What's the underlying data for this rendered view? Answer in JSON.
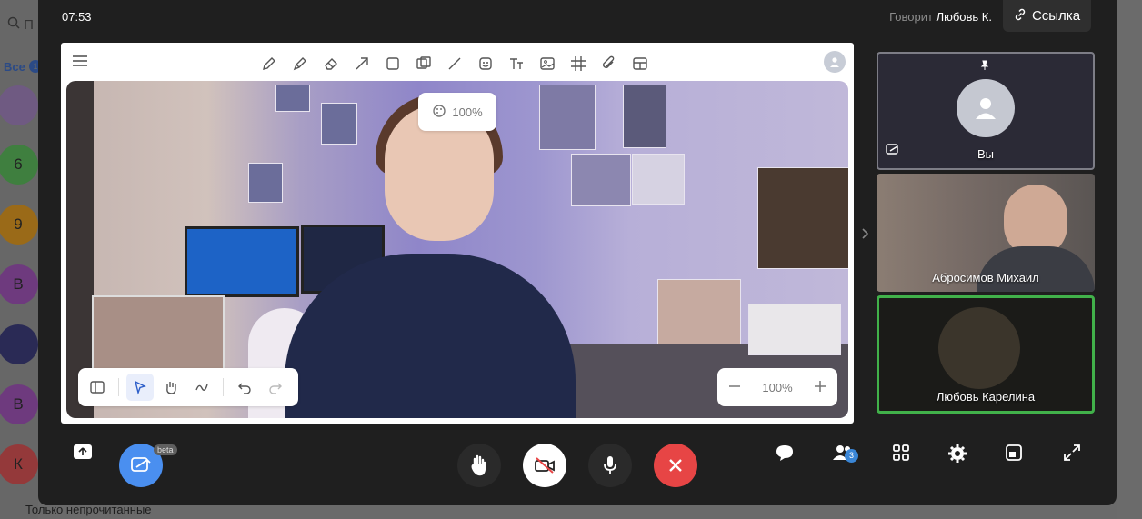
{
  "background_app": {
    "search_placeholder": "П",
    "filter_all": "Все",
    "filter_all_count": "1",
    "avatars": [
      {
        "letter": "",
        "color": "#7a5a8a"
      },
      {
        "letter": "6",
        "color": "#3f8a3f"
      },
      {
        "letter": "9",
        "color": "#b07a1a"
      },
      {
        "letter": "В",
        "color": "#7a3f8a"
      },
      {
        "letter": "",
        "color": "#2a2a5a"
      },
      {
        "letter": "В",
        "color": "#7a3f8a"
      },
      {
        "letter": "К",
        "color": "#a8403a"
      }
    ],
    "unread_only_label": "Только непрочитанные"
  },
  "call": {
    "clock": "07:53",
    "speaking_label": "Говорит",
    "speaking_name": "Любовь К.",
    "link_button": "Ссылка"
  },
  "board": {
    "top_zoom": "100%",
    "zoom_value": "100%",
    "tools": [
      "pencil-icon",
      "marker-icon",
      "eraser-icon",
      "arrow-icon",
      "rectangle-icon",
      "layers-icon",
      "line-icon",
      "sticker-icon",
      "text-icon",
      "image-icon",
      "grid-icon",
      "attach-icon",
      "table-icon"
    ]
  },
  "participants": [
    {
      "name": "Вы",
      "pinned": true
    },
    {
      "name": "Абросимов Михаил"
    },
    {
      "name": "Любовь Карелина",
      "speaking": true,
      "speaking_color": "#41b14a"
    }
  ],
  "controls": {
    "beta_label": "beta",
    "participants_count": "3",
    "end_call_color": "#e74545",
    "whiteboard_color": "#4a8ff0"
  }
}
